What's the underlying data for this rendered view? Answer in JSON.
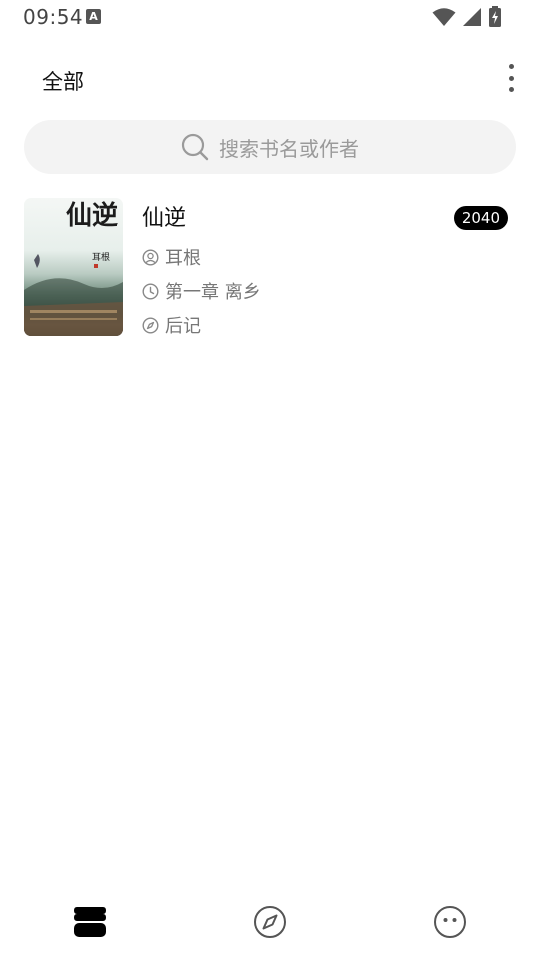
{
  "status_bar": {
    "time": "09:54",
    "keyboard_indicator": "A",
    "icons": [
      "wifi-icon",
      "signal-icon",
      "battery-charging-icon"
    ]
  },
  "header": {
    "title": "全部",
    "menu_icon": "more-vert-icon"
  },
  "search": {
    "placeholder": "搜索书名或作者",
    "icon": "search-icon"
  },
  "books": [
    {
      "title": "仙逆",
      "badge": "2040",
      "cover_text": "仙逆",
      "cover_author_text": "耳根",
      "author": "耳根",
      "latest_chapter": "第一章 离乡",
      "last_read": "后记"
    }
  ],
  "bottom_nav": {
    "items": [
      {
        "icon": "bookshelf-icon",
        "active": true
      },
      {
        "icon": "compass-icon",
        "active": false
      },
      {
        "icon": "smiley-icon",
        "active": false
      }
    ]
  },
  "colors": {
    "accent": "#000000",
    "secondary_text": "#777777",
    "search_bg": "#f3f3f3"
  }
}
